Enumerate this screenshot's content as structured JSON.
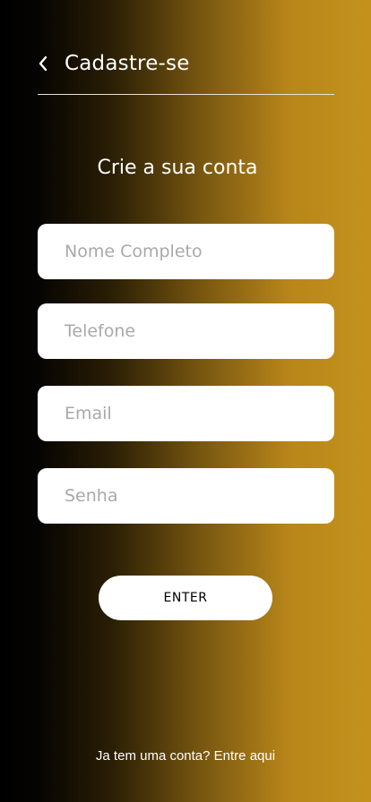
{
  "header": {
    "back_icon": "chevron-left-icon",
    "title": "Cadastre-se"
  },
  "form": {
    "heading": "Crie a sua conta",
    "fields": [
      {
        "placeholder": "Nome Completo",
        "value": ""
      },
      {
        "placeholder": "Telefone",
        "value": ""
      },
      {
        "placeholder": "Email",
        "value": ""
      },
      {
        "placeholder": "Senha",
        "value": ""
      }
    ],
    "submit_label": "ENTER"
  },
  "footer": {
    "question": "Ja tem uma conta?",
    "link_label": "Entre aqui"
  },
  "colors": {
    "gradient_start": "#000000",
    "gradient_end": "#c4921c",
    "field_bg": "#ffffff",
    "placeholder": "#a9a9a9"
  }
}
